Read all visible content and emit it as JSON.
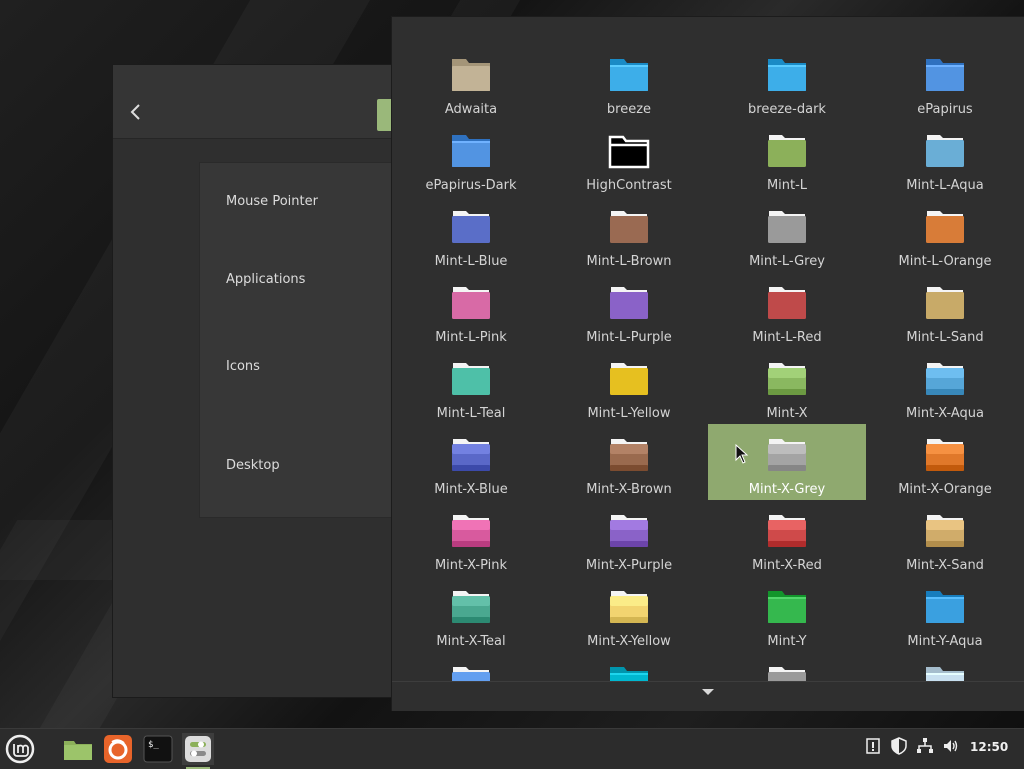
{
  "settings": {
    "back_icon": "chevron-left-icon",
    "rows": [
      "Mouse Pointer",
      "Applications",
      "Icons",
      "Desktop"
    ]
  },
  "icon_chooser": {
    "selected": "Mint-X-Grey",
    "themes": [
      {
        "name": "Adwaita",
        "color": "#c2b396",
        "style": "plain"
      },
      {
        "name": "breeze",
        "color": "#3daee9",
        "style": "flat"
      },
      {
        "name": "breeze-dark",
        "color": "#3daee9",
        "style": "flat"
      },
      {
        "name": "ePapirus",
        "color": "#5294e2",
        "style": "flat"
      },
      {
        "name": "ePapirus-Dark",
        "color": "#5294e2",
        "style": "flat"
      },
      {
        "name": "HighContrast",
        "color": "#000000",
        "style": "contrast"
      },
      {
        "name": "Mint-L",
        "color": "#8cb05a",
        "style": "mintl"
      },
      {
        "name": "Mint-L-Aqua",
        "color": "#6aaed6",
        "style": "mintl"
      },
      {
        "name": "Mint-L-Blue",
        "color": "#5a6ec8",
        "style": "mintl"
      },
      {
        "name": "Mint-L-Brown",
        "color": "#9a6a52",
        "style": "mintl"
      },
      {
        "name": "Mint-L-Grey",
        "color": "#9a9a9a",
        "style": "mintl"
      },
      {
        "name": "Mint-L-Orange",
        "color": "#d87c38",
        "style": "mintl"
      },
      {
        "name": "Mint-L-Pink",
        "color": "#d86aa6",
        "style": "mintl"
      },
      {
        "name": "Mint-L-Purple",
        "color": "#8a62c8",
        "style": "mintl"
      },
      {
        "name": "Mint-L-Red",
        "color": "#bf4a4a",
        "style": "mintl"
      },
      {
        "name": "Mint-L-Sand",
        "color": "#c8aa68",
        "style": "mintl"
      },
      {
        "name": "Mint-L-Teal",
        "color": "#4ec0a8",
        "style": "mintl"
      },
      {
        "name": "Mint-L-Yellow",
        "color": "#e6c020",
        "style": "mintl"
      },
      {
        "name": "Mint-X",
        "color": "#8ab860",
        "style": "mintx"
      },
      {
        "name": "Mint-X-Aqua",
        "color": "#56a6d8",
        "style": "mintx"
      },
      {
        "name": "Mint-X-Blue",
        "color": "#5a68c8",
        "style": "mintx"
      },
      {
        "name": "Mint-X-Brown",
        "color": "#9a6a4e",
        "style": "mintx"
      },
      {
        "name": "Mint-X-Grey",
        "color": "#a4a4a4",
        "style": "mintx"
      },
      {
        "name": "Mint-X-Orange",
        "color": "#e0782a",
        "style": "mintx"
      },
      {
        "name": "Mint-X-Pink",
        "color": "#d85a9e",
        "style": "mintx"
      },
      {
        "name": "Mint-X-Purple",
        "color": "#8a62c8",
        "style": "mintx"
      },
      {
        "name": "Mint-X-Red",
        "color": "#cf4a4a",
        "style": "mintx"
      },
      {
        "name": "Mint-X-Sand",
        "color": "#d0ac6a",
        "style": "mintx"
      },
      {
        "name": "Mint-X-Teal",
        "color": "#4aa890",
        "style": "mintx"
      },
      {
        "name": "Mint-X-Yellow",
        "color": "#f2d470",
        "style": "mintx"
      },
      {
        "name": "Mint-Y",
        "color": "#35b84e",
        "style": "flat"
      },
      {
        "name": "Mint-Y-Aqua",
        "color": "#3aa0e0",
        "style": "flat"
      },
      {
        "name": "",
        "color": "#4a86d8",
        "style": "mintx"
      },
      {
        "name": "",
        "color": "#00b8d0",
        "style": "flat"
      },
      {
        "name": "",
        "color": "#9a9a9a",
        "style": "mintl"
      },
      {
        "name": "",
        "color": "#c8e0f0",
        "style": "flat"
      }
    ]
  },
  "taskbar": {
    "apps": [
      {
        "name": "menu",
        "icon": "mint-menu-icon"
      },
      {
        "name": "files",
        "icon": "folder-icon"
      },
      {
        "name": "firefox",
        "icon": "firefox-icon"
      },
      {
        "name": "terminal",
        "icon": "terminal-icon"
      },
      {
        "name": "themes",
        "icon": "themes-settings-icon"
      }
    ],
    "tray": [
      "notes-icon",
      "shield-icon",
      "network-icon",
      "volume-icon"
    ],
    "clock": "12:50"
  }
}
